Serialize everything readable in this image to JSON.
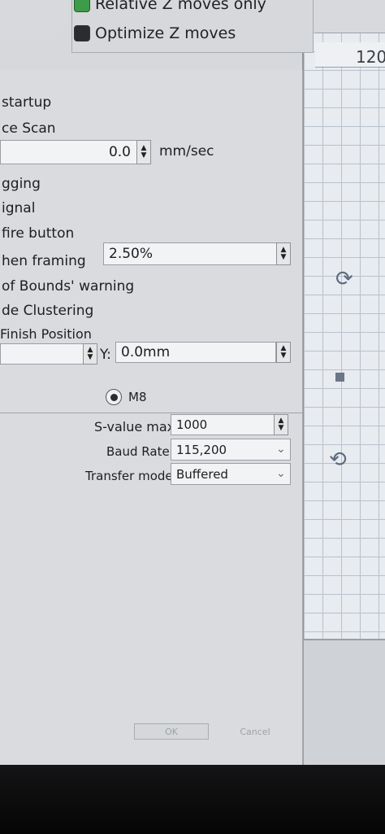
{
  "top_panel": {
    "relative_z": "Relative Z moves only",
    "optimize_z": "Optimize Z moves"
  },
  "canvas": {
    "ruler_label": "120"
  },
  "settings": {
    "startup": "startup",
    "face_scan": "ce Scan",
    "speed_value": "0.0",
    "speed_unit": "mm/sec",
    "gging": "gging",
    "signal": "ignal",
    "fire_button": "fire button",
    "framing_label": "hen framing",
    "framing_value": "2.50%",
    "out_of_bounds": "of Bounds' warning",
    "clustering": "de Clustering",
    "finish_position": "Finish Position",
    "y_label": "Y:",
    "y_value": "0.0mm"
  },
  "controller": {
    "m8_label": "M8",
    "svalue_label": "S-value max",
    "svalue_value": "1000",
    "baud_label": "Baud Rate",
    "baud_value": "115,200",
    "transfer_label": "Transfer mode",
    "transfer_value": "Buffered"
  },
  "buttons": {
    "ok": "OK",
    "cancel": "Cancel"
  }
}
